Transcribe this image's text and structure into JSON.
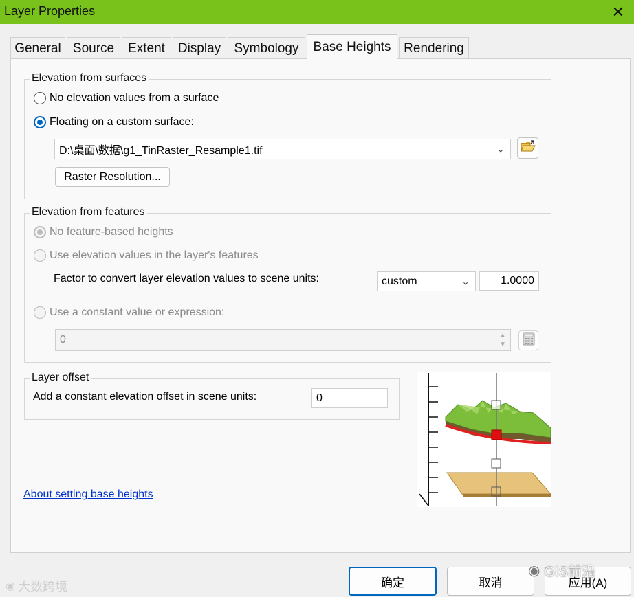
{
  "window": {
    "title": "Layer Properties",
    "close_glyph": "✕"
  },
  "tabs": [
    {
      "label": "General",
      "active": false
    },
    {
      "label": "Source",
      "active": false
    },
    {
      "label": "Extent",
      "active": false
    },
    {
      "label": "Display",
      "active": false
    },
    {
      "label": "Symbology",
      "active": false
    },
    {
      "label": "Base Heights",
      "active": true
    },
    {
      "label": "Rendering",
      "active": false
    }
  ],
  "surfaces": {
    "group_label": "Elevation from surfaces",
    "no_elevation_label": "No elevation values from a surface",
    "floating_label": "Floating on a custom surface:",
    "surface_path": "D:\\桌面\\数据\\g1_TinRaster_Resample1.tif",
    "raster_resolution_button": "Raster Resolution...",
    "selected": "floating"
  },
  "features": {
    "group_label": "Elevation from features",
    "no_feature_label": "No feature-based heights",
    "use_elevation_label": "Use elevation values in the layer's features",
    "factor_label": "Factor to convert layer elevation values to scene units:",
    "factor_unit": "custom",
    "factor_value": "1.0000",
    "constant_label": "Use a constant value or expression:",
    "constant_value": "0"
  },
  "offset": {
    "group_label": "Layer offset",
    "offset_label": "Add a constant elevation offset in scene units:",
    "offset_value": "0"
  },
  "help_link": "About setting base heights",
  "buttons": {
    "ok": "确定",
    "cancel": "取消",
    "apply": "应用(A)"
  },
  "watermarks": {
    "left": "大数跨境",
    "right": "GIS前沿"
  },
  "colors": {
    "titlebar": "#79c21c",
    "accent": "#0067c0",
    "link": "#0033cc"
  }
}
